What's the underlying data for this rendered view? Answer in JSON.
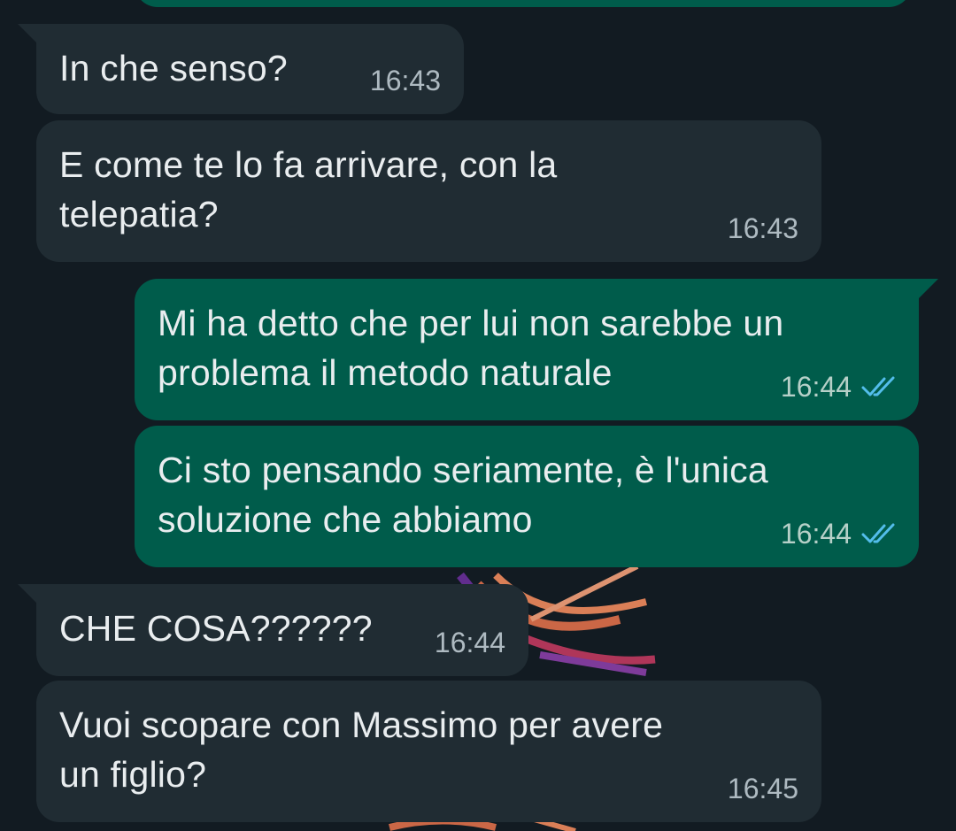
{
  "chat": {
    "messages": [
      {
        "id": "m1",
        "direction": "incoming",
        "text": "In che senso?",
        "time": "16:43"
      },
      {
        "id": "m2",
        "direction": "incoming",
        "text": "E come te lo fa arrivare, con la\ntelepatia?",
        "time": "16:43"
      },
      {
        "id": "m3",
        "direction": "outgoing",
        "text": "Mi ha detto che per lui non sarebbe un\nproblema il metodo naturale",
        "time": "16:44",
        "status_icon": "double-check-read-icon"
      },
      {
        "id": "m4",
        "direction": "outgoing",
        "text": "Ci sto pensando seriamente, è l'unica\nsoluzione che abbiamo",
        "time": "16:44",
        "status_icon": "double-check-read-icon"
      },
      {
        "id": "m5",
        "direction": "incoming",
        "text": "CHE COSA??????",
        "time": "16:44"
      },
      {
        "id": "m6",
        "direction": "incoming",
        "text": "Vuoi scopare con Massimo per avere\nun figlio?",
        "time": "16:45"
      }
    ]
  },
  "colors": {
    "background": "#121b22",
    "incoming_bubble": "#202c33",
    "outgoing_bubble": "#005c4b",
    "text": "#e9edef",
    "read_ticks": "#53bdeb"
  }
}
